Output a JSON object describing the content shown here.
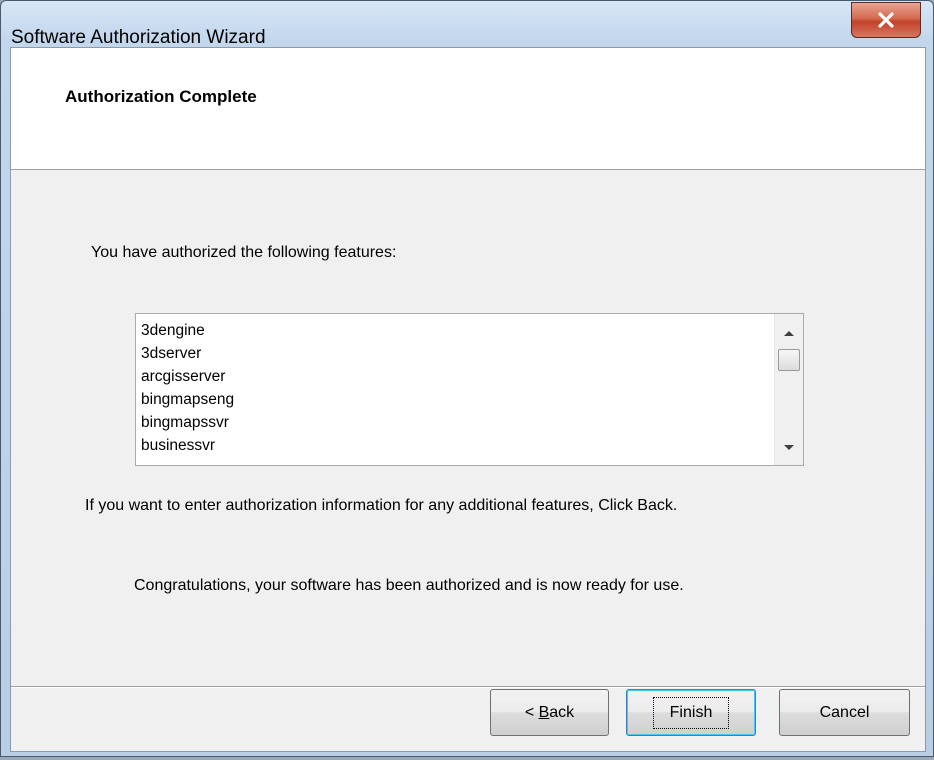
{
  "window": {
    "title": "Software Authorization Wizard",
    "close_glyph": "x"
  },
  "header": {
    "title": "Authorization Complete"
  },
  "body": {
    "intro": "You have authorized the following features:",
    "features": [
      "3dengine",
      "3dserver",
      "arcgisserver",
      "bingmapseng",
      "bingmapssvr",
      "businessvr"
    ],
    "back_hint": "If you want to enter authorization information for any additional features, Click Back.",
    "congrats": "Congratulations, your software has been authorized and is now ready for use."
  },
  "buttons": {
    "back_prefix": "< ",
    "back_mnemonic": "B",
    "back_rest": "ack",
    "finish": "Finish",
    "cancel": "Cancel"
  },
  "colors": {
    "close_button": "#c7432b",
    "default_button_border": "#3c7fb1"
  }
}
